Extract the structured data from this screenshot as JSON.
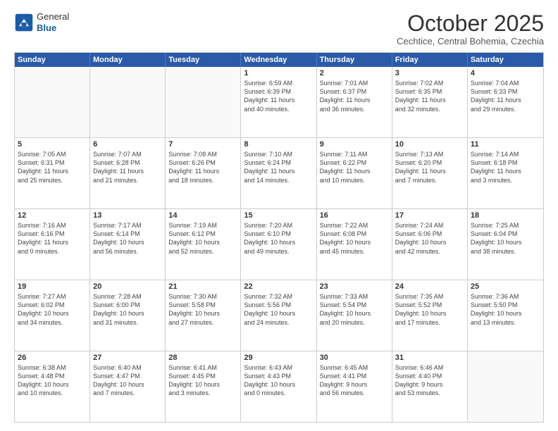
{
  "header": {
    "logo": {
      "general": "General",
      "blue": "Blue"
    },
    "title": "October 2025",
    "location": "Cechtice, Central Bohemia, Czechia"
  },
  "weekdays": [
    "Sunday",
    "Monday",
    "Tuesday",
    "Wednesday",
    "Thursday",
    "Friday",
    "Saturday"
  ],
  "rows": [
    [
      {
        "day": "",
        "info": ""
      },
      {
        "day": "",
        "info": ""
      },
      {
        "day": "",
        "info": ""
      },
      {
        "day": "1",
        "info": "Sunrise: 6:59 AM\nSunset: 6:39 PM\nDaylight: 11 hours\nand 40 minutes."
      },
      {
        "day": "2",
        "info": "Sunrise: 7:01 AM\nSunset: 6:37 PM\nDaylight: 11 hours\nand 36 minutes."
      },
      {
        "day": "3",
        "info": "Sunrise: 7:02 AM\nSunset: 6:35 PM\nDaylight: 11 hours\nand 32 minutes."
      },
      {
        "day": "4",
        "info": "Sunrise: 7:04 AM\nSunset: 6:33 PM\nDaylight: 11 hours\nand 29 minutes."
      }
    ],
    [
      {
        "day": "5",
        "info": "Sunrise: 7:05 AM\nSunset: 6:31 PM\nDaylight: 11 hours\nand 25 minutes."
      },
      {
        "day": "6",
        "info": "Sunrise: 7:07 AM\nSunset: 6:28 PM\nDaylight: 11 hours\nand 21 minutes."
      },
      {
        "day": "7",
        "info": "Sunrise: 7:08 AM\nSunset: 6:26 PM\nDaylight: 11 hours\nand 18 minutes."
      },
      {
        "day": "8",
        "info": "Sunrise: 7:10 AM\nSunset: 6:24 PM\nDaylight: 11 hours\nand 14 minutes."
      },
      {
        "day": "9",
        "info": "Sunrise: 7:11 AM\nSunset: 6:22 PM\nDaylight: 11 hours\nand 10 minutes."
      },
      {
        "day": "10",
        "info": "Sunrise: 7:13 AM\nSunset: 6:20 PM\nDaylight: 11 hours\nand 7 minutes."
      },
      {
        "day": "11",
        "info": "Sunrise: 7:14 AM\nSunset: 6:18 PM\nDaylight: 11 hours\nand 3 minutes."
      }
    ],
    [
      {
        "day": "12",
        "info": "Sunrise: 7:16 AM\nSunset: 6:16 PM\nDaylight: 11 hours\nand 0 minutes."
      },
      {
        "day": "13",
        "info": "Sunrise: 7:17 AM\nSunset: 6:14 PM\nDaylight: 10 hours\nand 56 minutes."
      },
      {
        "day": "14",
        "info": "Sunrise: 7:19 AM\nSunset: 6:12 PM\nDaylight: 10 hours\nand 52 minutes."
      },
      {
        "day": "15",
        "info": "Sunrise: 7:20 AM\nSunset: 6:10 PM\nDaylight: 10 hours\nand 49 minutes."
      },
      {
        "day": "16",
        "info": "Sunrise: 7:22 AM\nSunset: 6:08 PM\nDaylight: 10 hours\nand 45 minutes."
      },
      {
        "day": "17",
        "info": "Sunrise: 7:24 AM\nSunset: 6:06 PM\nDaylight: 10 hours\nand 42 minutes."
      },
      {
        "day": "18",
        "info": "Sunrise: 7:25 AM\nSunset: 6:04 PM\nDaylight: 10 hours\nand 38 minutes."
      }
    ],
    [
      {
        "day": "19",
        "info": "Sunrise: 7:27 AM\nSunset: 6:02 PM\nDaylight: 10 hours\nand 34 minutes."
      },
      {
        "day": "20",
        "info": "Sunrise: 7:28 AM\nSunset: 6:00 PM\nDaylight: 10 hours\nand 31 minutes."
      },
      {
        "day": "21",
        "info": "Sunrise: 7:30 AM\nSunset: 5:58 PM\nDaylight: 10 hours\nand 27 minutes."
      },
      {
        "day": "22",
        "info": "Sunrise: 7:32 AM\nSunset: 5:56 PM\nDaylight: 10 hours\nand 24 minutes."
      },
      {
        "day": "23",
        "info": "Sunrise: 7:33 AM\nSunset: 5:54 PM\nDaylight: 10 hours\nand 20 minutes."
      },
      {
        "day": "24",
        "info": "Sunrise: 7:35 AM\nSunset: 5:52 PM\nDaylight: 10 hours\nand 17 minutes."
      },
      {
        "day": "25",
        "info": "Sunrise: 7:36 AM\nSunset: 5:50 PM\nDaylight: 10 hours\nand 13 minutes."
      }
    ],
    [
      {
        "day": "26",
        "info": "Sunrise: 6:38 AM\nSunset: 4:48 PM\nDaylight: 10 hours\nand 10 minutes."
      },
      {
        "day": "27",
        "info": "Sunrise: 6:40 AM\nSunset: 4:47 PM\nDaylight: 10 hours\nand 7 minutes."
      },
      {
        "day": "28",
        "info": "Sunrise: 6:41 AM\nSunset: 4:45 PM\nDaylight: 10 hours\nand 3 minutes."
      },
      {
        "day": "29",
        "info": "Sunrise: 6:43 AM\nSunset: 4:43 PM\nDaylight: 10 hours\nand 0 minutes."
      },
      {
        "day": "30",
        "info": "Sunrise: 6:45 AM\nSunset: 4:41 PM\nDaylight: 9 hours\nand 56 minutes."
      },
      {
        "day": "31",
        "info": "Sunrise: 6:46 AM\nSunset: 4:40 PM\nDaylight: 9 hours\nand 53 minutes."
      },
      {
        "day": "",
        "info": ""
      }
    ]
  ]
}
